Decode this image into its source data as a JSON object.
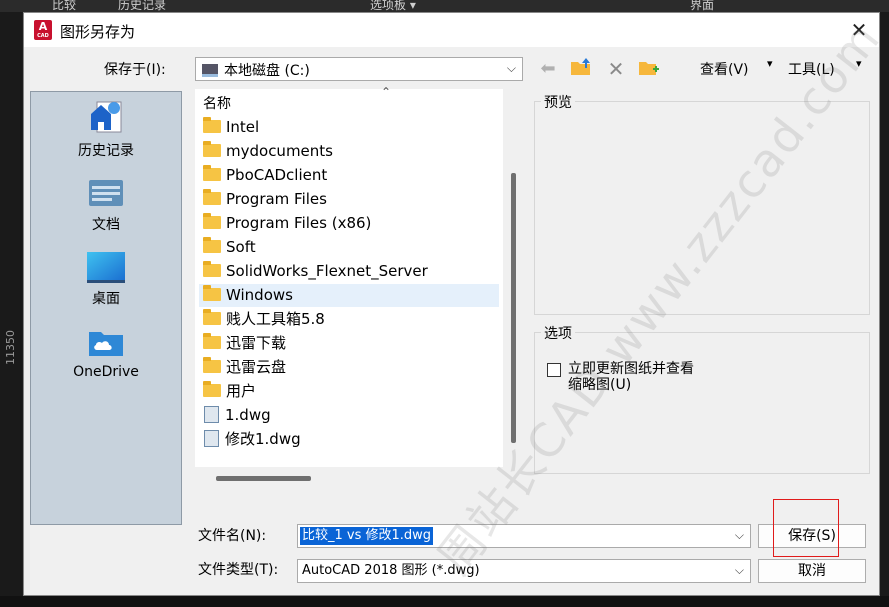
{
  "background": {
    "tabs": [
      "比较",
      "历史记录",
      "选项板 ▾",
      "界面"
    ],
    "ruler_value": "11350"
  },
  "dialog": {
    "title": "图形另存为",
    "app_icon_text": "A",
    "app_icon_sub": "CAD",
    "save_in_label": "保存于(I):",
    "save_in_value": "本地磁盘 (C:)",
    "toolbar": {
      "back_icon": "back-arrow-icon",
      "up_icon": "up-folder-icon",
      "delete_icon": "delete-icon",
      "new_folder_icon": "new-folder-icon",
      "views_label": "查看(V)",
      "tools_label": "工具(L)"
    },
    "places": [
      {
        "label": "历史记录",
        "icon": "history-icon"
      },
      {
        "label": "文档",
        "icon": "documents-icon"
      },
      {
        "label": "桌面",
        "icon": "desktop-icon"
      },
      {
        "label": "OneDrive",
        "icon": "onedrive-icon"
      }
    ],
    "file_list": {
      "column_header": "名称",
      "items": [
        {
          "name": "Intel",
          "type": "folder"
        },
        {
          "name": "mydocuments",
          "type": "folder"
        },
        {
          "name": "PboCADclient",
          "type": "folder"
        },
        {
          "name": "Program Files",
          "type": "folder"
        },
        {
          "name": "Program Files (x86)",
          "type": "folder"
        },
        {
          "name": "Soft",
          "type": "folder"
        },
        {
          "name": "SolidWorks_Flexnet_Server",
          "type": "folder"
        },
        {
          "name": "Windows",
          "type": "folder",
          "selected": true
        },
        {
          "name": "贱人工具箱5.8",
          "type": "folder"
        },
        {
          "name": "迅雷下载",
          "type": "folder"
        },
        {
          "name": "迅雷云盘",
          "type": "folder"
        },
        {
          "name": "用户",
          "type": "folder"
        },
        {
          "name": "1.dwg",
          "type": "dwg"
        },
        {
          "name": "修改1.dwg",
          "type": "dwg"
        }
      ]
    },
    "preview_label": "预览",
    "options_label": "选项",
    "options_checkbox_label_line1": "立即更新图纸并查看",
    "options_checkbox_label_line2": "缩略图(U)",
    "filename_label": "文件名(N):",
    "filename_value": "比较_1 vs 修改1.dwg",
    "filetype_label": "文件类型(T):",
    "filetype_value": "AutoCAD 2018 图形 (*.dwg)",
    "save_button": "保存(S)",
    "cancel_button": "取消",
    "close_glyph": "✕"
  },
  "watermark": "周站长CAD www.zzzcad.com"
}
